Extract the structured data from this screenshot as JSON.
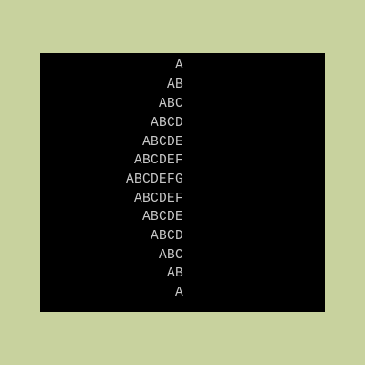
{
  "colors": {
    "page_background": "#c8d29e",
    "console_background": "#000000",
    "console_text": "#c8c8c8"
  },
  "console": {
    "lines": [
      "A",
      "AB",
      "ABC",
      "ABCD",
      "ABCDE",
      "ABCDEF",
      "ABCDEFG",
      "ABCDEF",
      "ABCDE",
      "ABCD",
      "ABC",
      "AB",
      "A"
    ]
  }
}
